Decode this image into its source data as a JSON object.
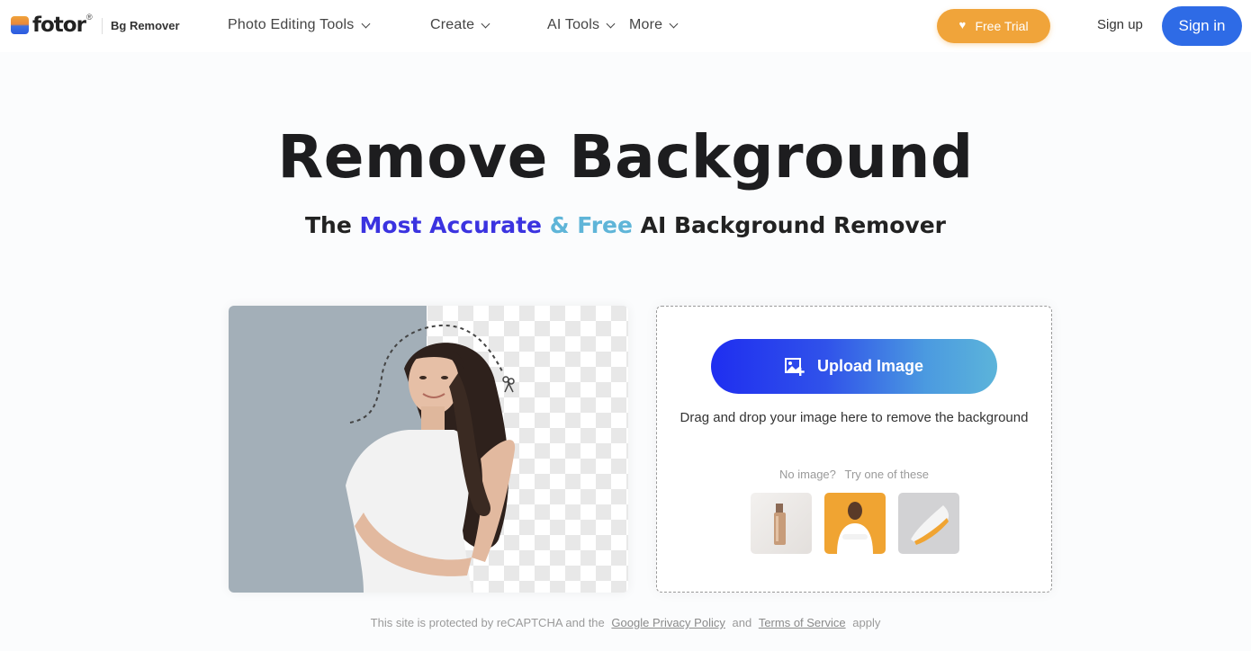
{
  "header": {
    "logo_text": "fotor",
    "logo_reg": "®",
    "product": "Bg Remover",
    "nav": [
      {
        "label": "Photo Editing Tools",
        "icon": "chevron-down-icon"
      },
      {
        "label": "Create",
        "icon": "chevron-down-icon"
      },
      {
        "label": "AI Tools",
        "icon": "chevron-down-icon"
      },
      {
        "label": "More",
        "icon": "chevron-down-icon"
      }
    ],
    "free_trial_label": "Free Trial",
    "sign_up_label": "Sign up",
    "sign_in_label": "Sign in"
  },
  "hero": {
    "title": "Remove Background",
    "subtitle_pre": "The ",
    "subtitle_hl1": "Most Accurate",
    "subtitle_hl2": " & Free",
    "subtitle_post": " AI Background Remover"
  },
  "upload": {
    "button_label": "Upload Image",
    "drop_text": "Drag and drop your image here to remove the background",
    "no_image": "No image?",
    "try_one": "Try one of these",
    "samples": [
      {
        "name": "cosmetic-bottle"
      },
      {
        "name": "woman-orange-bg"
      },
      {
        "name": "sneaker"
      }
    ]
  },
  "footer": {
    "pre": "This site is protected by reCAPTCHA and the",
    "privacy_link": "Google Privacy Policy",
    "and": "and",
    "terms_link": "Terms of Service",
    "post": "apply"
  },
  "colors": {
    "accent_blue": "#2e6be6",
    "trial_orange": "#f0a43a",
    "highlight_indigo": "#3b33e0",
    "highlight_cyan": "#5fb5d8"
  }
}
